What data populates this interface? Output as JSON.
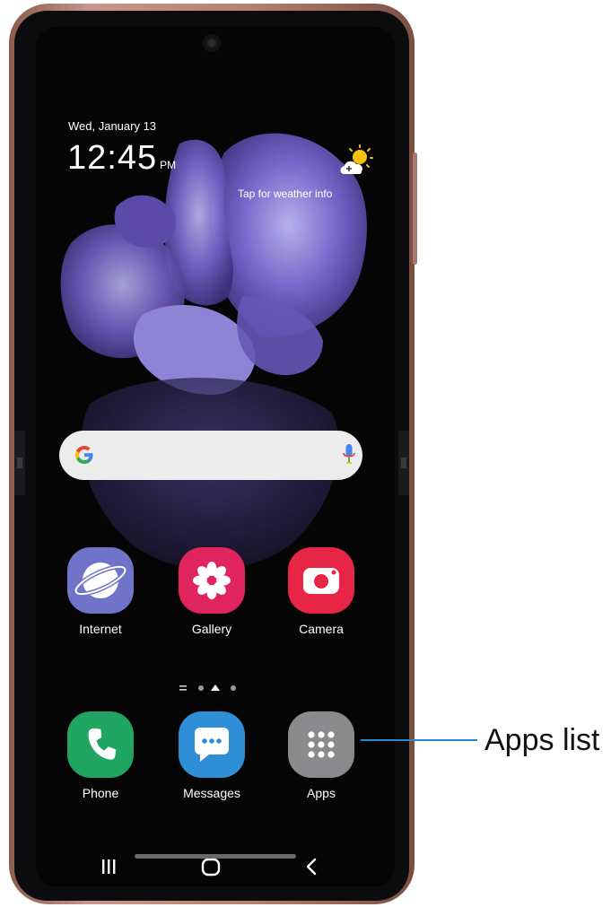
{
  "status": {
    "date": "Wed, January 13",
    "time": "12:45",
    "ampm": "PM",
    "weather_prompt": "Tap for weather info",
    "weather_icon": "partly-sunny-icon"
  },
  "search": {
    "logo": "google-g-icon",
    "mic": "mic-icon"
  },
  "home_apps": [
    {
      "label": "Internet",
      "icon": "internet-icon",
      "color": "#6f74c9"
    },
    {
      "label": "Gallery",
      "icon": "gallery-icon",
      "color": "#e0245e"
    },
    {
      "label": "Camera",
      "icon": "camera-icon",
      "color": "#e72544"
    }
  ],
  "dock_apps": [
    {
      "label": "Phone",
      "icon": "phone-icon",
      "color": "#1fa461"
    },
    {
      "label": "Messages",
      "icon": "messages-icon",
      "color": "#2f8fd6"
    },
    {
      "label": "Apps",
      "icon": "apps-grid-icon",
      "color": "#8a8a8d"
    }
  ],
  "page_indicator": {
    "pages": 3,
    "current": 2
  },
  "navigation": {
    "recents": "recents-icon",
    "home": "home-icon",
    "back": "back-icon"
  },
  "callout": {
    "label": "Apps list",
    "color": "#2a87c8"
  }
}
